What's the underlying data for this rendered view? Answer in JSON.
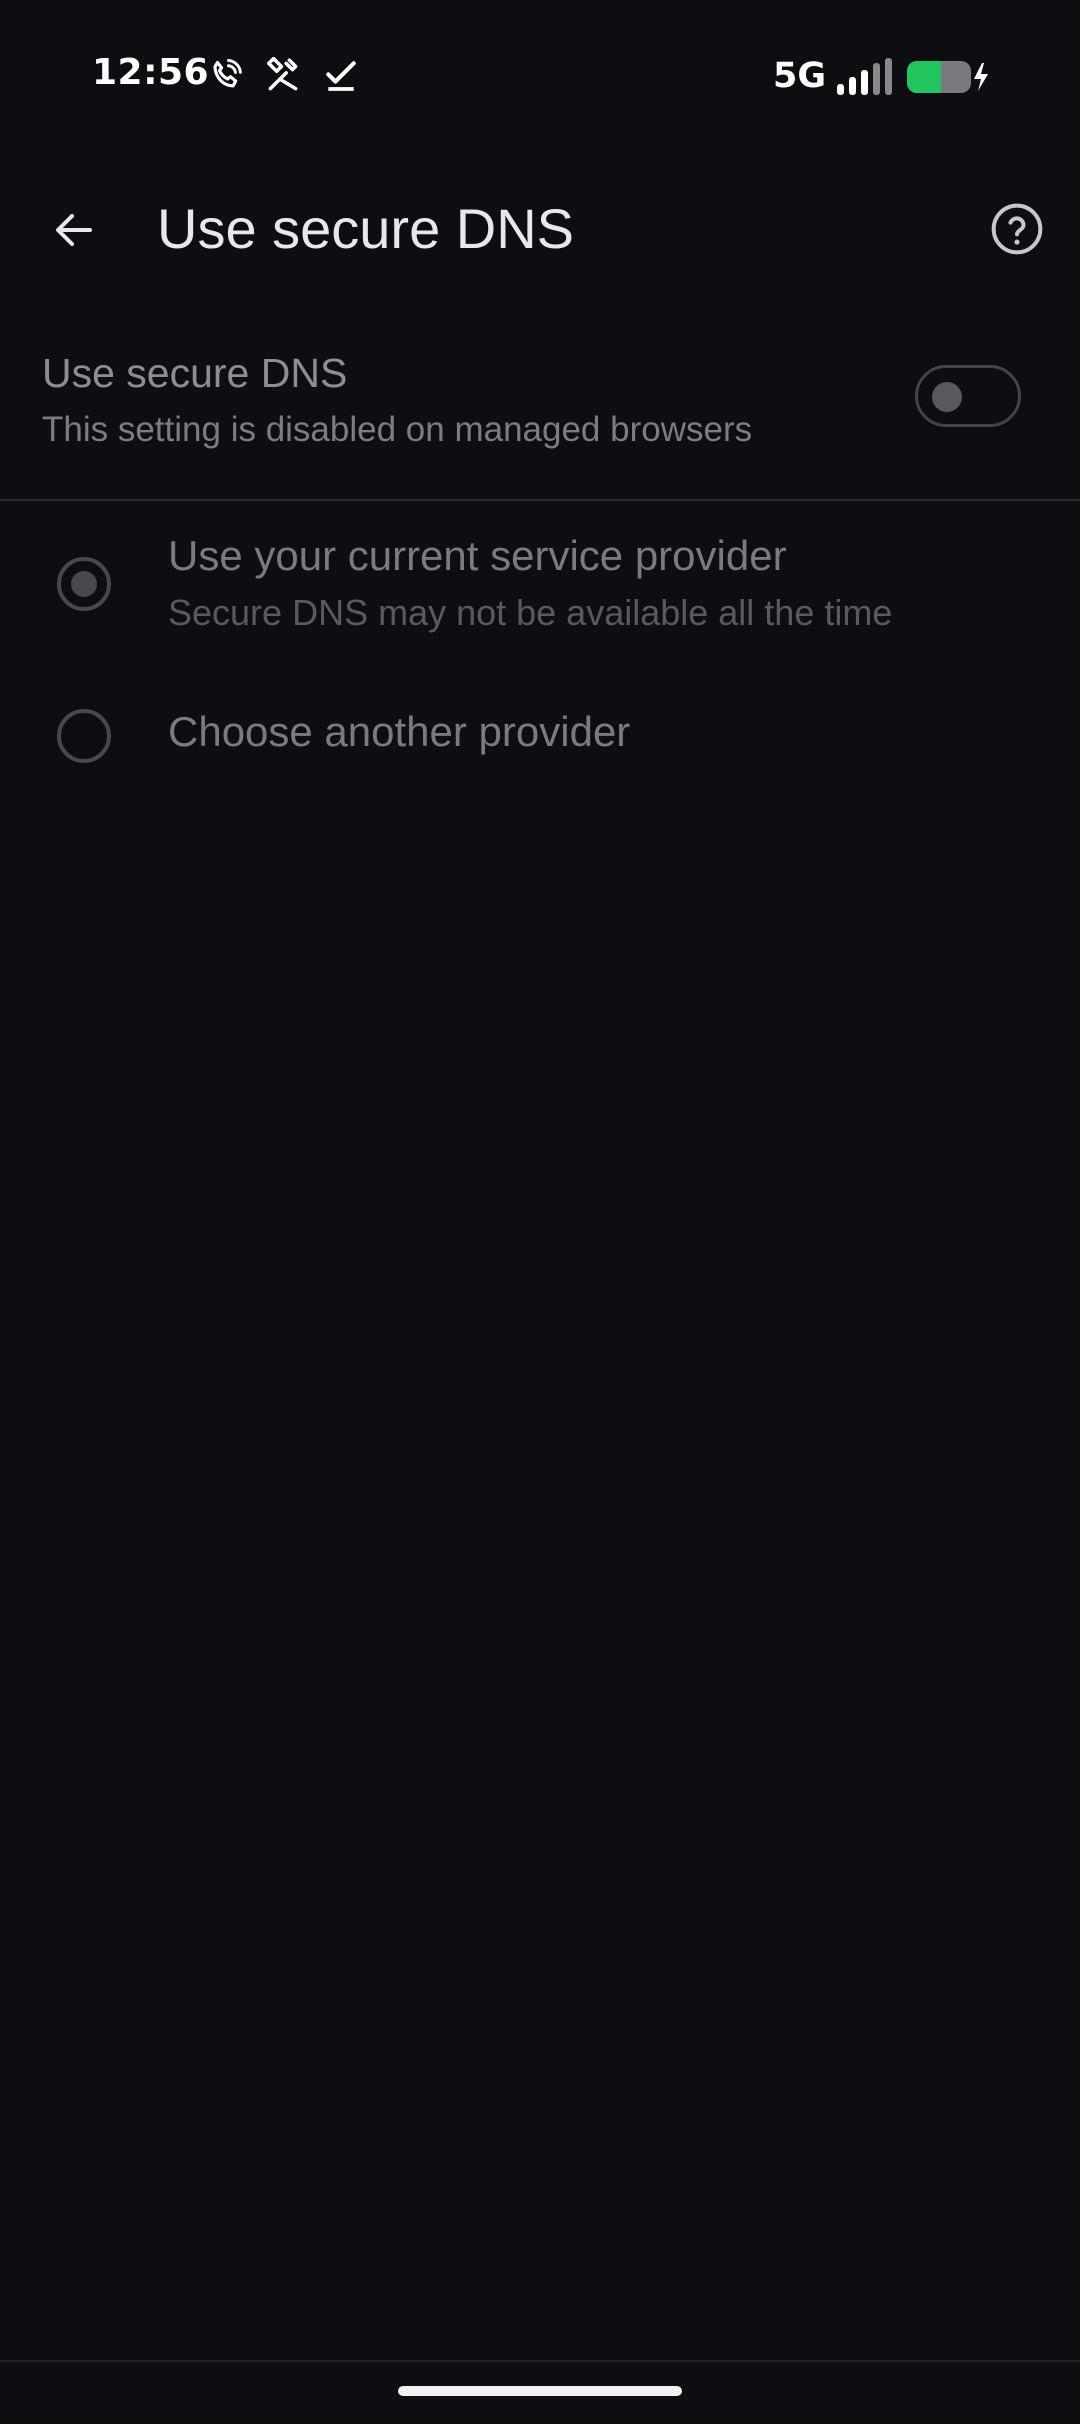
{
  "status_bar": {
    "time": "12:56",
    "network": "5G",
    "icons": [
      "wifi-calling-icon",
      "tools-icon",
      "task-done-icon",
      "signal-icon",
      "battery-charging-icon"
    ],
    "battery_color": "#22c55e"
  },
  "app_bar": {
    "title": "Use secure DNS",
    "back_icon": "arrow-back-icon",
    "help_icon": "help-circle-icon"
  },
  "secure_dns_toggle": {
    "title": "Use secure DNS",
    "subtitle": "This setting is disabled on managed browsers",
    "enabled": false,
    "disabled": true
  },
  "provider_options": [
    {
      "label": "Use your current service provider",
      "description": "Secure DNS may not be available all the time",
      "selected": true
    },
    {
      "label": "Choose another provider",
      "selected": false
    }
  ],
  "colors": {
    "background": "#0e0d12",
    "title_text": "#e9e7ee",
    "disabled_text": "#7c7a81"
  }
}
